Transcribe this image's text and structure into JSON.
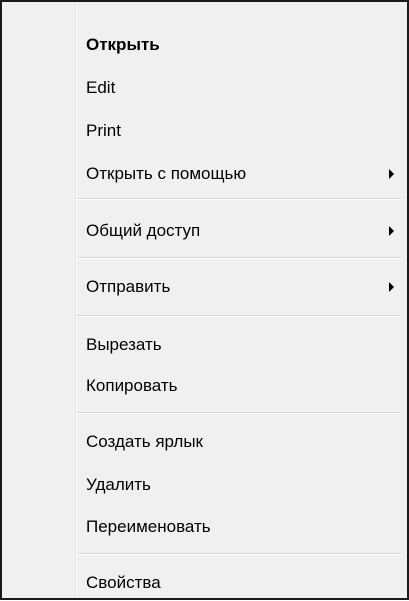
{
  "context_menu": {
    "items": [
      {
        "label": "Открыть"
      },
      {
        "label": "Edit"
      },
      {
        "label": "Print"
      },
      {
        "label": "Открыть с помощью"
      },
      {
        "label": "Общий доступ"
      },
      {
        "label": "Отправить"
      },
      {
        "label": "Вырезать"
      },
      {
        "label": "Копировать"
      },
      {
        "label": "Создать ярлык"
      },
      {
        "label": "Удалить"
      },
      {
        "label": "Переименовать"
      },
      {
        "label": "Свойства"
      }
    ],
    "submenu_arrow_icon": "triangle-right-icon",
    "colors": {
      "background": "#f0f0f0",
      "border": "#1a1a1a",
      "text": "#000000",
      "separator": "#d7d7d7"
    }
  }
}
